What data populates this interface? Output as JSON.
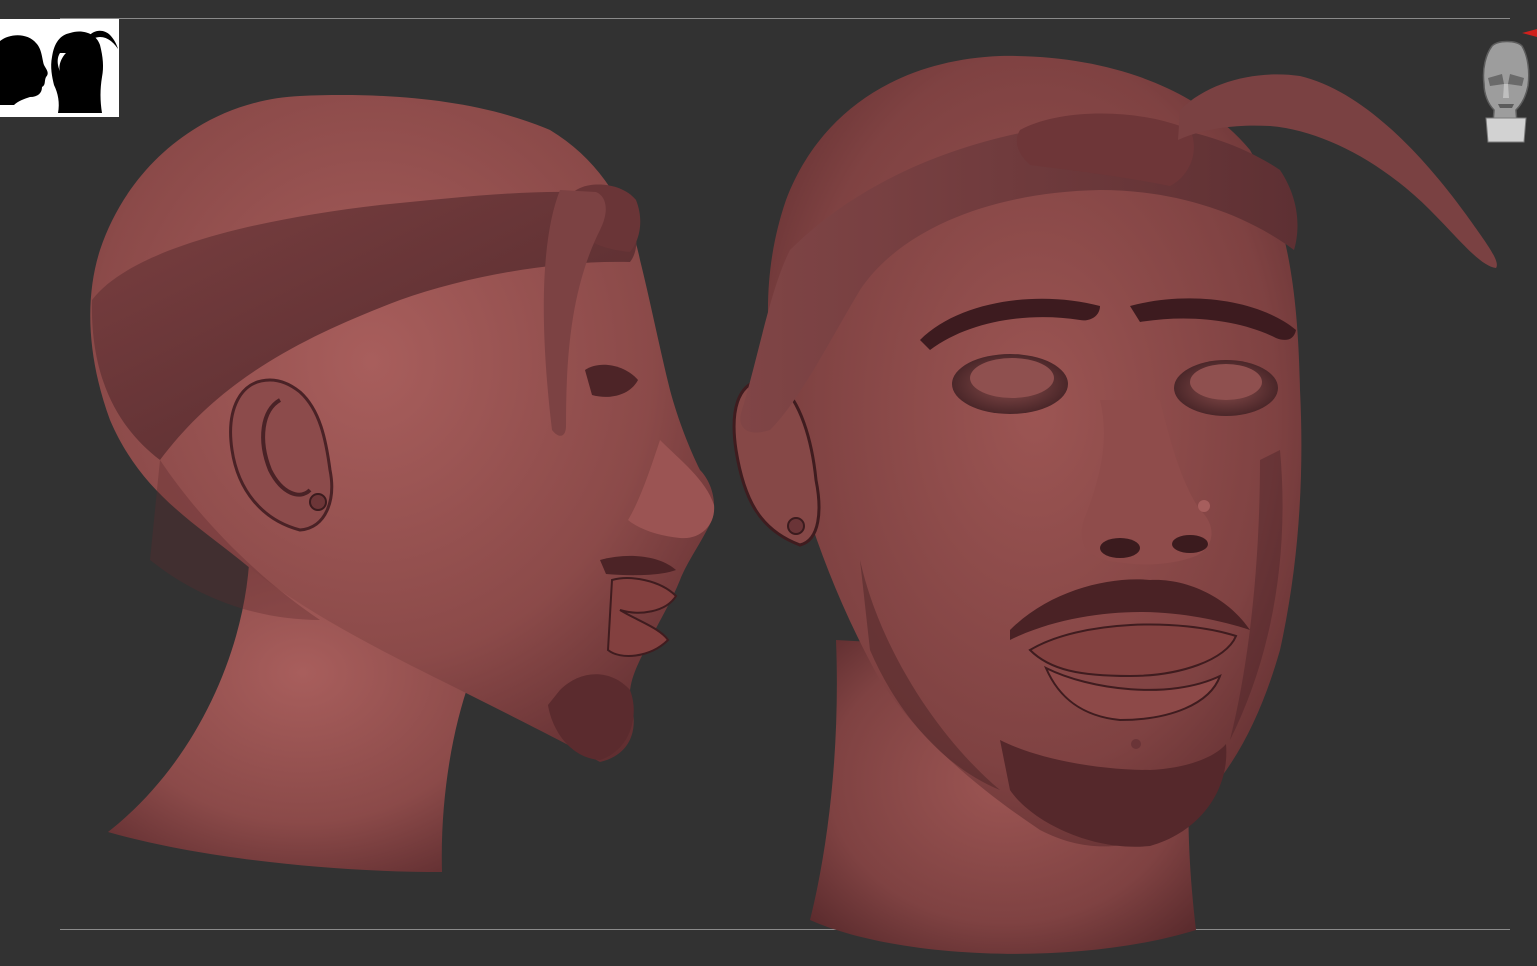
{
  "window": {
    "background": "#323232",
    "frame_line_color": "#8a8a8a"
  },
  "reference_thumbnail": {
    "icon": "head-silhouettes-icon",
    "background": "#ffffff",
    "silhouette_color": "#000000"
  },
  "canvas": {
    "material_color": "#8e4a4a",
    "highlight_color": "#b57070",
    "shadow_color": "#3f1c1f",
    "models": [
      {
        "id": "head-side-view",
        "icon": "sculpted-head-profile"
      },
      {
        "id": "head-front-view",
        "icon": "sculpted-head-three-quarter"
      }
    ]
  },
  "navigation_gizmo": {
    "icon": "gizmo-head-icon",
    "color": "#bdbdbd"
  },
  "indicator": {
    "icon": "red-triangle-icon",
    "color": "#d0201c"
  }
}
